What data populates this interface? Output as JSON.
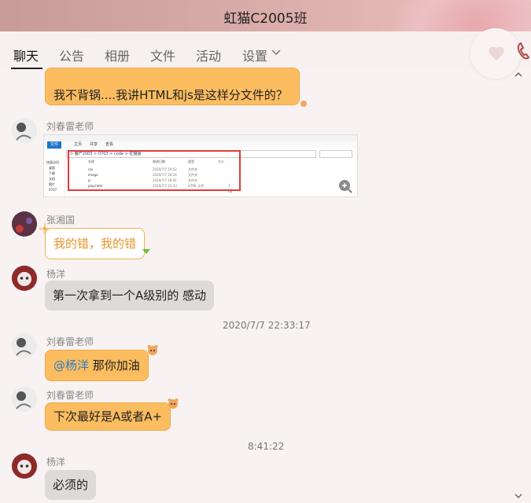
{
  "window": {
    "title": "虹猫C2005班"
  },
  "tabs": [
    {
      "label": "聊天"
    },
    {
      "label": "公告"
    },
    {
      "label": "相册"
    },
    {
      "label": "文件"
    },
    {
      "label": "活动"
    },
    {
      "label": "设置"
    }
  ],
  "messages": [
    {
      "sender": "",
      "text": "我不背锅....我讲HTML和js是这样分文件的？"
    },
    {
      "sender": "刘春雷老师",
      "text": ""
    },
    {
      "sender": "张湘国",
      "text": "我的错，我的错"
    },
    {
      "sender": "杨洋",
      "text": "第一次拿到一个A级别的  感动"
    },
    {
      "time": "2020/7/7 22:33:17"
    },
    {
      "sender": "刘春雷老师",
      "mention": "@杨洋",
      "text": " 那你加油"
    },
    {
      "sender": "刘春雷老师",
      "text": "下次最好是A或者A+"
    },
    {
      "time": "8:41:22"
    },
    {
      "sender": "杨洋",
      "text": "必须的"
    }
  ],
  "screenshot": {
    "nav": [
      "文件",
      "主页",
      "共享",
      "查看"
    ],
    "path": "> 鹿产2005 > 0703 > code > 虹猫圈",
    "columns": [
      "名称",
      "修改日期",
      "类型",
      "大小"
    ],
    "files": [
      {
        "name": "css",
        "date": "2020/7/7 19:52",
        "type": "文件夹",
        "size": ""
      },
      {
        "name": "image",
        "date": "2020/7/7 20:16",
        "type": "文件夹",
        "size": ""
      },
      {
        "name": "js",
        "date": "2020/7/7 19:41",
        "type": "文件夹",
        "size": ""
      },
      {
        "name": "play.html",
        "date": "2020/7/7 21:43",
        "type": "HTML 文件",
        "size": "1 KB"
      }
    ],
    "sidebar": [
      "快速访问",
      "桌面",
      "下载",
      "文档",
      "图片",
      "0707"
    ]
  },
  "colors": {
    "bubble_self": "#fbbd60",
    "bubble_other": "#dedada",
    "mention": "#2d7cc9",
    "highlight_box": "#e23b3b"
  },
  "icons": [
    "heart-icon",
    "phone-icon",
    "chevron-down-icon",
    "zoom-in-icon",
    "scroll-up-icon",
    "scroll-down-icon"
  ]
}
